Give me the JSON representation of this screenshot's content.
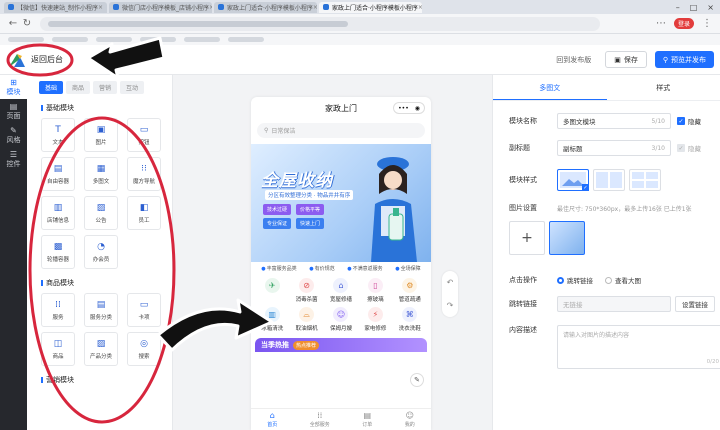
{
  "browser": {
    "tabs": [
      {
        "label": "【微信】快速建站_制作小程序"
      },
      {
        "label": "微信门店小程序模板_店铺小程序"
      },
      {
        "label": "家政上门适合·小程序模板小程序"
      }
    ],
    "login_label": "登录"
  },
  "header": {
    "back_label": "返回后台",
    "history_label": "回到发布版",
    "save_label": "保存",
    "publish_label": "预览并发布"
  },
  "rail": [
    {
      "label": "模块"
    },
    {
      "label": "页面"
    },
    {
      "label": "风格"
    },
    {
      "label": "控件"
    }
  ],
  "components": {
    "tabs": [
      "基础",
      "商品",
      "营销",
      "互动"
    ],
    "sections": [
      {
        "title": "基础模块",
        "items": [
          {
            "label": "文本",
            "icon": "T"
          },
          {
            "label": "图片",
            "icon": "▣"
          },
          {
            "label": "按钮",
            "icon": "▭"
          },
          {
            "label": "自由容器",
            "icon": "▤"
          },
          {
            "label": "多图文",
            "icon": "▦"
          },
          {
            "label": "魔方导航",
            "icon": "⁝⁝"
          },
          {
            "label": "店铺信息",
            "icon": "▥"
          },
          {
            "label": "公告",
            "icon": "▨"
          },
          {
            "label": "员工",
            "icon": "◧"
          },
          {
            "label": "轮播容器",
            "icon": "▩"
          },
          {
            "label": "办会员",
            "icon": "◔"
          }
        ]
      },
      {
        "title": "商品模块",
        "items": [
          {
            "label": "服务",
            "icon": "⁞⁞"
          },
          {
            "label": "服务分类",
            "icon": "▤"
          },
          {
            "label": "卡项",
            "icon": "▭"
          },
          {
            "label": "商品",
            "icon": "◫"
          },
          {
            "label": "产品分类",
            "icon": "▨"
          },
          {
            "label": "搜索",
            "icon": "◎"
          }
        ]
      },
      {
        "title": "营销模块",
        "items": []
      }
    ]
  },
  "phone": {
    "title": "家政上门",
    "search_placeholder": "日常保洁",
    "banner_title": "全屋收纳",
    "banner_sub": "分区有效整理分类 · 物品井井有序",
    "banner_tags": [
      "技术过硬",
      "价格平等",
      "专业保证",
      "快速上门"
    ],
    "assurances": [
      "丰富服务品类",
      "有价规范",
      "不满意返服务",
      "全场保障"
    ],
    "services": [
      {
        "label": "",
        "icon": "✈",
        "color": "#e9f6ee",
        "ic": "#3aa668"
      },
      {
        "label": "消毒杀菌",
        "icon": "⊘",
        "color": "#fdecec",
        "ic": "#e05050"
      },
      {
        "label": "宽屋修缮",
        "icon": "⌂",
        "color": "#eef1fd",
        "ic": "#4a63d8"
      },
      {
        "label": "擦玻璃",
        "icon": "▯",
        "color": "#fbeef6",
        "ic": "#cf4a9a"
      },
      {
        "label": "管道疏通",
        "icon": "⚙",
        "color": "#fdf4e6",
        "ic": "#e09030"
      },
      {
        "label": "冰箱清洗",
        "icon": "▥",
        "color": "#e8f4fd",
        "ic": "#2f8ad6"
      },
      {
        "label": "取油烟机",
        "icon": "⌓",
        "color": "#fdf2e6",
        "ic": "#e2872e"
      },
      {
        "label": "保姆月嫂",
        "icon": "☺",
        "color": "#f1edfd",
        "ic": "#7a55f0"
      },
      {
        "label": "家电修修",
        "icon": "⚡",
        "color": "#fdecec",
        "ic": "#e05050"
      },
      {
        "label": "洗衣洗鞋",
        "icon": "⌘",
        "color": "#eef1fd",
        "ic": "#4a63d8"
      }
    ],
    "hot_title": "当季热推",
    "hot_tag": "热点推荐",
    "tabbar": [
      {
        "label": "首页",
        "icon": "⌂"
      },
      {
        "label": "全部服务",
        "icon": "⁞⁞"
      },
      {
        "label": "订单",
        "icon": "▤"
      },
      {
        "label": "我的",
        "icon": "☺"
      }
    ]
  },
  "settings": {
    "tabs": [
      "多图文",
      "样式"
    ],
    "module_name_label": "模块名称",
    "module_name_value": "多图文模块",
    "module_name_count": "5/10",
    "hide_label": "隐藏",
    "subtitle_label": "副标题",
    "subtitle_value": "副标题",
    "subtitle_count": "3/10",
    "style_label": "模块样式",
    "image_label": "图片设置",
    "image_hint": "最佳尺寸: 750*360px，最多上传16张   已上传1张",
    "click_label": "点击操作",
    "click_options": [
      "跳转链接",
      "查看大图"
    ],
    "link_label": "跳转链接",
    "link_placeholder": "无链接",
    "link_button": "设置链接",
    "desc_label": "内容描述",
    "desc_placeholder": "请输入对图片的描述内容",
    "desc_count": "0/20"
  }
}
